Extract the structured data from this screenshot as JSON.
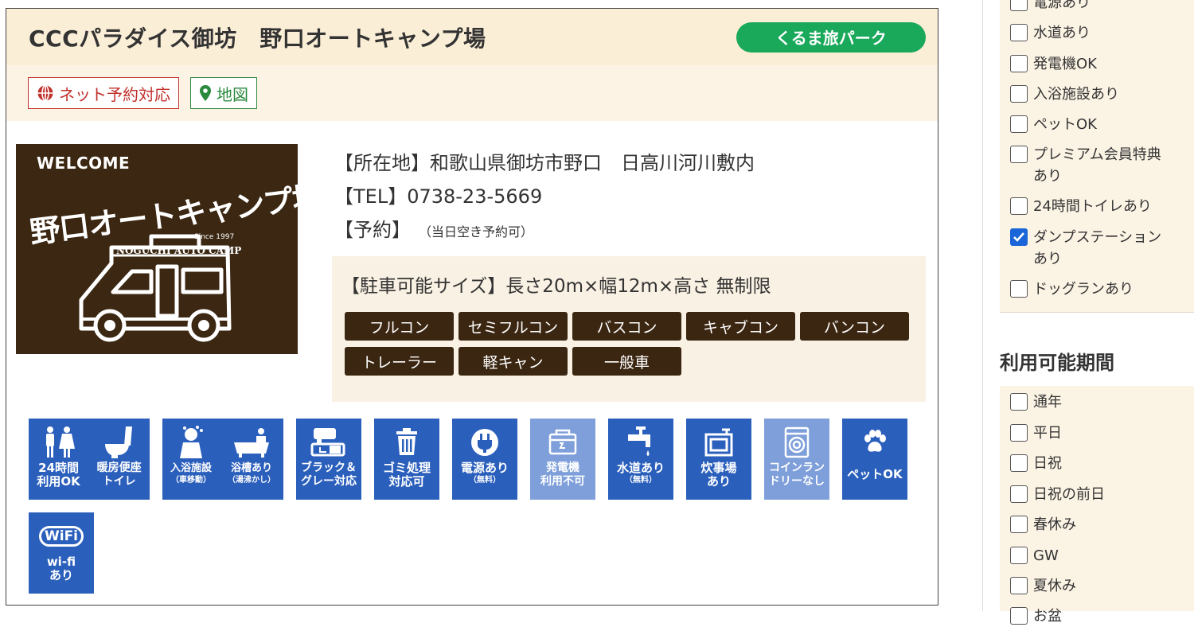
{
  "campsite": {
    "title": "CCCパラダイス御坊　野口オートキャンプ場",
    "badge": "くるま旅パーク",
    "tags": {
      "net": "ネット予約対応",
      "map": "地図"
    },
    "logo": {
      "welcome": "WELCOME",
      "name": "野口オートキャンプ場",
      "since": "Since 1997",
      "camp": "NOGUCHI AUTO CAMP"
    },
    "address": "【所在地】和歌山県御坊市野口　日高川河川敷内",
    "tel": "【TEL】0738-23-5669",
    "reserve_label": "【予約】",
    "reserve_note": "（当日空き予約可）",
    "parking_size": "【駐車可能サイズ】長さ20m×幅12m×高さ 無制限",
    "vehicles": [
      "フルコン",
      "セミフルコン",
      "バスコン",
      "キャブコン",
      "バンコン",
      "トレーラー",
      "軽キャン",
      "一般車"
    ]
  },
  "amenities": {
    "toilet": {
      "a1": "24時間",
      "a2": "利用OK",
      "b1": "暖房便座",
      "b2": "トイレ"
    },
    "bath": {
      "a1": "入浴施設",
      "a2": "（車移動）",
      "b1": "浴槽あり",
      "b2": "（湯沸かし）"
    },
    "black_gray": {
      "l1": "ブラック＆",
      "l2": "グレー対応"
    },
    "garbage": {
      "l1": "ゴミ処理",
      "l2": "対応可"
    },
    "power": {
      "l1": "電源あり",
      "l2": "（無料）"
    },
    "generator": {
      "l1": "発電機",
      "l2": "利用不可"
    },
    "water": {
      "l1": "水道あり",
      "l2": "（無料）"
    },
    "kitchen": {
      "l1": "炊事場",
      "l2": "あり"
    },
    "laundry": {
      "l1": "コインラン",
      "l2": "ドリーなし"
    },
    "pet": {
      "l1": "ペットOK"
    },
    "wifi": {
      "badge": "WiFi",
      "l1": "wi-fi",
      "l2": "あり"
    }
  },
  "sidebar": {
    "facilities": [
      {
        "label": "電源あり",
        "checked": false
      },
      {
        "label": "水道あり",
        "checked": false
      },
      {
        "label": "発電機OK",
        "checked": false
      },
      {
        "label": "入浴施設あり",
        "checked": false
      },
      {
        "label": "ペットOK",
        "checked": false
      },
      {
        "label": "プレミアム会員特典",
        "label2": "あり",
        "checked": false
      },
      {
        "label": "24時間トイレあり",
        "checked": false
      },
      {
        "label": "ダンプステーション",
        "label2": "あり",
        "checked": true
      },
      {
        "label": "ドッグランあり",
        "checked": false
      }
    ],
    "period_heading": "利用可能期間",
    "periods": [
      {
        "label": "通年"
      },
      {
        "label": "平日"
      },
      {
        "label": "日祝"
      },
      {
        "label": "日祝の前日"
      },
      {
        "label": "春休み"
      },
      {
        "label": "GW"
      },
      {
        "label": "夏休み"
      },
      {
        "label": "お盆"
      }
    ]
  },
  "colors": {
    "accent_green": "#1aa85a",
    "amenity_blue": "#2b5fbc",
    "amenity_disabled": "#7e9fda",
    "vehicle_brown": "#3b2611",
    "check_blue": "#1a66d8"
  }
}
